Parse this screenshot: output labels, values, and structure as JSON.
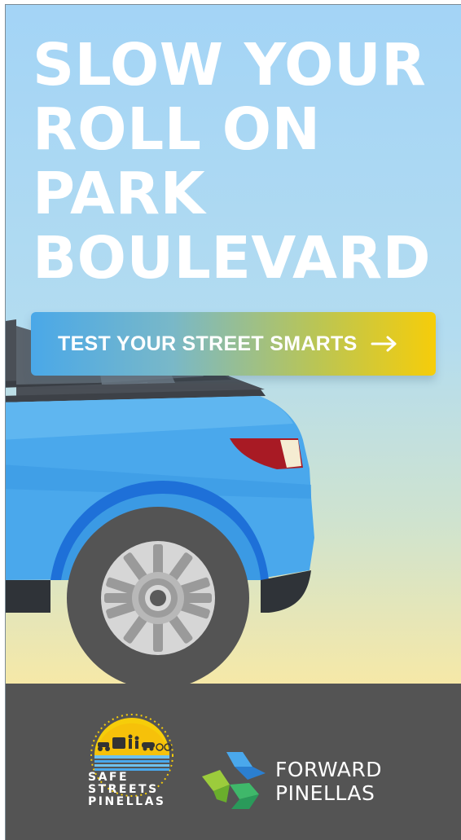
{
  "headline": {
    "lines": [
      "SLOW YOUR",
      "ROLL ON",
      "PARK",
      "BOULEVARD"
    ]
  },
  "cta": {
    "label": "TEST YOUR STREET SMARTS",
    "icon": "arrow-right-icon"
  },
  "colors": {
    "sky_top": "#a3d4f6",
    "ground": "#fbe9a2",
    "car_body": "#4aa8ec",
    "cta_start": "#4aa8e8",
    "cta_end": "#f6cd0a",
    "footer": "#545454"
  },
  "logos": {
    "safe_streets": {
      "lines": [
        "SAFE",
        "STREETS",
        "PINELLAS"
      ]
    },
    "forward_pinellas": {
      "lines": [
        "FORWARD",
        "PINELLAS"
      ]
    }
  }
}
